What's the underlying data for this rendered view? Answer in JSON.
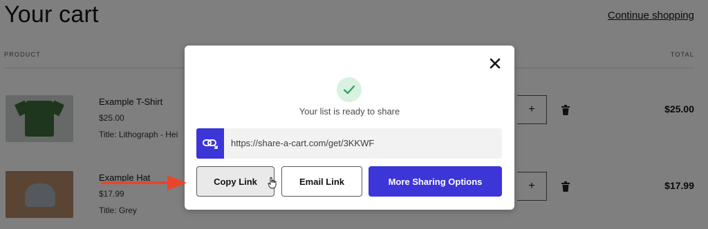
{
  "page": {
    "title": "Your cart",
    "continue_link": "Continue shopping",
    "columns": {
      "product": "PRODUCT",
      "total": "TOTAL"
    }
  },
  "cart": {
    "items": [
      {
        "name": "Example T-Shirt",
        "price": "$25.00",
        "meta": "Title: Lithograph - Hei",
        "quantity_plus": "+",
        "total": "$25.00"
      },
      {
        "name": "Example Hat",
        "price": "$17.99",
        "meta": "Title: Grey",
        "quantity_plus": "+",
        "total": "$17.99"
      }
    ]
  },
  "modal": {
    "status": "Your list is ready to share",
    "url": "https://share-a-cart.com/get/3KKWF",
    "buttons": {
      "copy": "Copy Link",
      "email": "Email Link",
      "more": "More Sharing Options"
    }
  },
  "colors": {
    "accent": "#3c35d8",
    "success_bg": "#d9f1e0",
    "success_check": "#2f9e5b",
    "annotation_arrow": "#e8452c"
  },
  "icons": [
    "close-icon",
    "check-icon",
    "link-icon",
    "trash-icon",
    "pointer-cursor-icon",
    "annotation-arrow"
  ]
}
